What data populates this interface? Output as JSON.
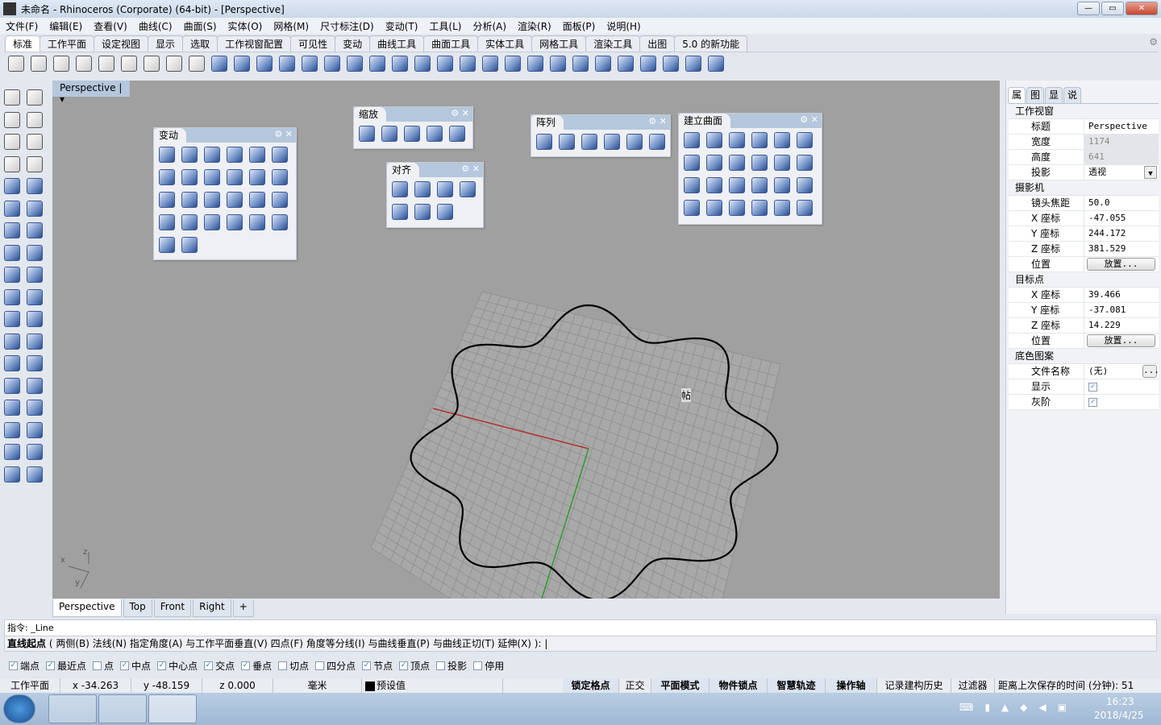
{
  "window": {
    "title": "未命名 - Rhinoceros (Corporate) (64-bit) - [Perspective]",
    "buttons": {
      "minimize": "—",
      "maximize": "▭",
      "close": "✕"
    }
  },
  "menu": [
    "文件(F)",
    "编辑(E)",
    "查看(V)",
    "曲线(C)",
    "曲面(S)",
    "实体(O)",
    "网格(M)",
    "尺寸标注(D)",
    "变动(T)",
    "工具(L)",
    "分析(A)",
    "渲染(R)",
    "面板(P)",
    "说明(H)"
  ],
  "tabs": [
    "标准",
    "工作平面",
    "设定视图",
    "显示",
    "选取",
    "工作视窗配置",
    "可见性",
    "变动",
    "曲线工具",
    "曲面工具",
    "实体工具",
    "网格工具",
    "渲染工具",
    "出图",
    "5.0 的新功能"
  ],
  "toolbar_icons": [
    "new",
    "open",
    "save",
    "print",
    "import",
    "cut",
    "copy",
    "paste",
    "undo",
    "pan",
    "move",
    "zoom-in",
    "zoom-window",
    "zoom-extents",
    "zoom-selected",
    "rotate-view",
    "four-viewports",
    "car",
    "object-properties",
    "circle-point",
    "select-points",
    "light",
    "lock",
    "layer",
    "color-wheel",
    "shaded",
    "rendered",
    "sphere",
    "filter",
    "settings",
    "cplane",
    "help"
  ],
  "viewport": {
    "label": "Perspective",
    "tabs": [
      "Perspective",
      "Top",
      "Front",
      "Right",
      "+"
    ],
    "axes": {
      "x": "x",
      "y": "y",
      "z": "z"
    },
    "cursor_label": "帖"
  },
  "panels": {
    "transform": {
      "title": "变动",
      "count": 26
    },
    "scale": {
      "title": "缩放",
      "count": 5
    },
    "align": {
      "title": "对齐",
      "count": 7
    },
    "array": {
      "title": "阵列",
      "count": 6
    },
    "surface": {
      "title": "建立曲面",
      "count": 24
    }
  },
  "right_panel": {
    "tabs": [
      "属",
      "图",
      "显",
      "说"
    ],
    "sections": [
      {
        "title": "工作视窗",
        "rows": [
          {
            "k": "标题",
            "v": "Perspective"
          },
          {
            "k": "宽度",
            "v": "1174",
            "disabled": true
          },
          {
            "k": "高度",
            "v": "641",
            "disabled": true
          },
          {
            "k": "投影",
            "v": "透视",
            "dropdown": true
          }
        ]
      },
      {
        "title": "摄影机",
        "rows": [
          {
            "k": "镜头焦距",
            "v": "50.0"
          },
          {
            "k": "X 座标",
            "v": "-47.055"
          },
          {
            "k": "Y 座标",
            "v": "244.172"
          },
          {
            "k": "Z 座标",
            "v": "381.529"
          },
          {
            "k": "位置",
            "button": "放置..."
          }
        ]
      },
      {
        "title": "目标点",
        "rows": [
          {
            "k": "X 座标",
            "v": "39.466"
          },
          {
            "k": "Y 座标",
            "v": "-37.081"
          },
          {
            "k": "Z 座标",
            "v": "14.229"
          },
          {
            "k": "位置",
            "button": "放置..."
          }
        ]
      },
      {
        "title": "底色图案",
        "rows": [
          {
            "k": "文件名称",
            "v": "(无)",
            "browse": "..."
          },
          {
            "k": "显示",
            "check": true
          },
          {
            "k": "灰阶",
            "check": true
          }
        ]
      }
    ]
  },
  "command": {
    "history": "指令: _Line",
    "prompt_bold": "直线起点",
    "prompt": " ( 两侧(B)  法线(N)  指定角度(A)  与工作平面垂直(V)  四点(F)  角度等分线(I)  与曲线垂直(P)  与曲线正切(T)  延伸(X) ): |"
  },
  "osnap": [
    {
      "label": "端点",
      "on": true
    },
    {
      "label": "最近点",
      "on": true
    },
    {
      "label": "点",
      "on": false
    },
    {
      "label": "中点",
      "on": true
    },
    {
      "label": "中心点",
      "on": true
    },
    {
      "label": "交点",
      "on": true
    },
    {
      "label": "垂点",
      "on": true
    },
    {
      "label": "切点",
      "on": false
    },
    {
      "label": "四分点",
      "on": false
    },
    {
      "label": "节点",
      "on": true
    },
    {
      "label": "顶点",
      "on": true
    },
    {
      "label": "投影",
      "on": false
    },
    {
      "label": "停用",
      "on": false
    }
  ],
  "status": {
    "cplane": "工作平面",
    "x": "x -34.263",
    "y": "y -48.159",
    "z": "z 0.000",
    "units": "毫米",
    "layer": "预设值",
    "toggles": [
      "锁定格点",
      "正交",
      "平面模式",
      "物件锁点",
      "智慧轨迹",
      "操作轴",
      "记录建构历史",
      "过滤器"
    ],
    "save_time": "距离上次保存的时间 (分钟): 51"
  },
  "taskbar": {
    "time": "16:23",
    "date": "2018/4/25"
  },
  "colors": {
    "viewport_bg": "#a0a0a0",
    "grid": "#8a8a8a",
    "x_axis": "#b03030",
    "y_axis": "#2f9a2f",
    "curve": "#000000"
  }
}
